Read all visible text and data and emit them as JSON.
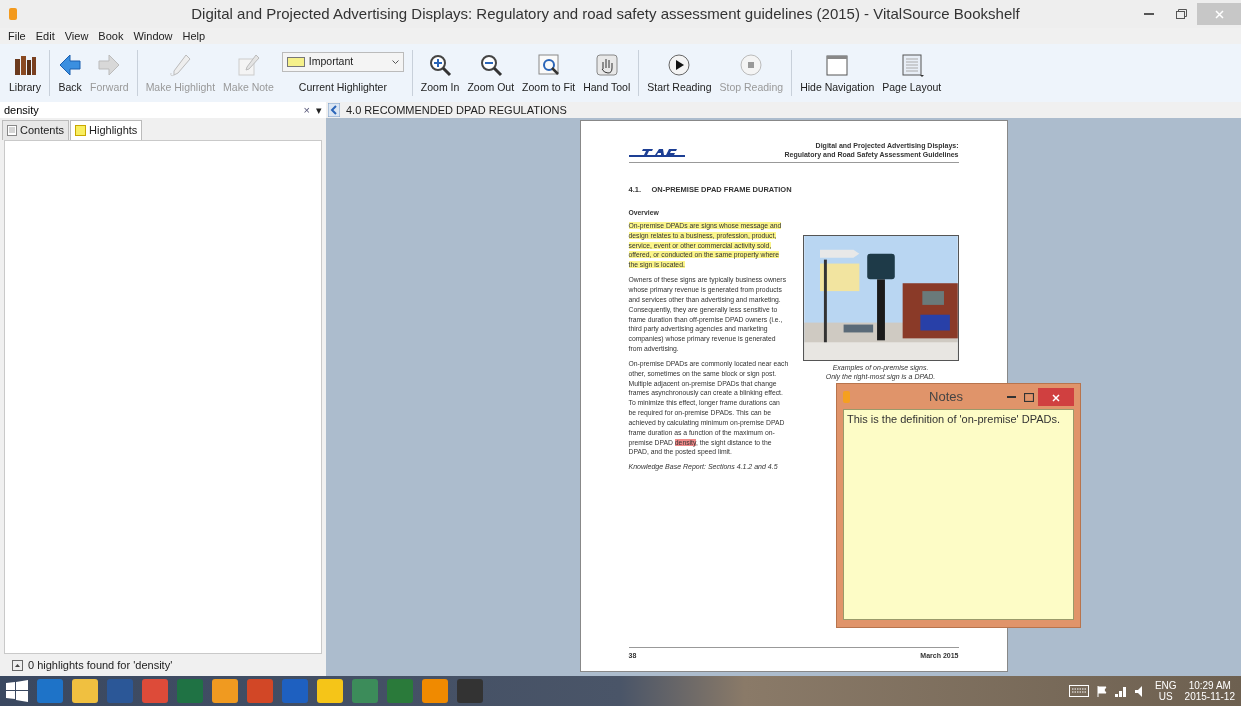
{
  "window": {
    "title": "Digital and Projected Advertising Displays: Regulatory and road safety assessment guidelines (2015) - VitalSource Bookshelf"
  },
  "menu": [
    "File",
    "Edit",
    "View",
    "Book",
    "Window",
    "Help"
  ],
  "toolbar": [
    {
      "kind": "button",
      "label": "Library",
      "disabled": false
    },
    {
      "kind": "separator"
    },
    {
      "kind": "button",
      "label": "Back",
      "disabled": false
    },
    {
      "kind": "button",
      "label": "Forward",
      "disabled": true
    },
    {
      "kind": "separator"
    },
    {
      "kind": "button",
      "label": "Make Highlight",
      "disabled": true
    },
    {
      "kind": "button",
      "label": "Make Note",
      "disabled": true
    },
    {
      "kind": "dropdown",
      "value": "Important",
      "color": "#f5f08a",
      "label": "Current Highlighter",
      "disabled": false
    },
    {
      "kind": "separator"
    },
    {
      "kind": "button",
      "label": "Zoom In",
      "disabled": false
    },
    {
      "kind": "button",
      "label": "Zoom Out",
      "disabled": false
    },
    {
      "kind": "button",
      "label": "Zoom to Fit",
      "disabled": false
    },
    {
      "kind": "button",
      "label": "Hand Tool",
      "disabled": false
    },
    {
      "kind": "separator"
    },
    {
      "kind": "button",
      "label": "Start Reading",
      "disabled": false
    },
    {
      "kind": "button",
      "label": "Stop Reading",
      "disabled": true
    },
    {
      "kind": "separator"
    },
    {
      "kind": "button",
      "label": "Hide Navigation",
      "disabled": false
    },
    {
      "kind": "button",
      "label": "Page Layout",
      "disabled": false
    }
  ],
  "search": {
    "value": "density",
    "clear": "×",
    "menu": "▾"
  },
  "nav_tabs": [
    {
      "label": "Contents",
      "selected": false
    },
    {
      "label": "Highlights",
      "selected": true
    }
  ],
  "status": "0 highlights found for 'density'",
  "breadcrumb": "4.0 RECOMMENDED DPAD REGULATIONS",
  "page": {
    "header": [
      "Digital and Projected Advertising Displays:",
      "Regulatory and Road Safety Assessment Guidelines"
    ],
    "section": "4.1.     ON-PREMISE DPAD FRAME DURATION",
    "subhead": "Overview",
    "paragraphs": [
      {
        "kind": "body",
        "segments": [
          {
            "text": "On-premise DPADs are signs whose message and design relates to a business, profession, product, service, event or other commercial activity sold, offered, or conducted on the same property where the sign is located.",
            "highlighted": true,
            "color": "#fbf58a"
          }
        ]
      },
      {
        "kind": "body",
        "segments": [
          {
            "text": "Owners of these signs are typically business owners whose primary revenue is generated from products and services other than advertising and marketing. Consequently, they are generally less sensitive to frame duration than off-premise DPAD owners (i.e., third party advertising agencies and marketing companies) whose primary revenue is generated from advertising.",
            "highlighted": false
          }
        ]
      },
      {
        "kind": "body",
        "segments": [
          {
            "text": "On-premise DPADs are commonly located near each other, sometimes on the same block or sign post. Multiple adjacent on-premise DPADs that change frames asynchronously can create a blinking effect. To minimize this effect, longer frame durations can be required for on-premise DPADs. This can be achieved by calculating minimum on-premise DPAD frame duration as a function of the maximum on-premise DPAD ",
            "highlighted": false
          },
          {
            "text": "density",
            "highlighted": true,
            "color": "#f08a8a"
          },
          {
            "text": ", the sight distance to the DPAD, and the posted speed limit.",
            "highlighted": false
          }
        ]
      },
      {
        "kind": "reference",
        "segments": [
          {
            "text": "Knowledge Base Report: Sections 4.1.2 and 4.5",
            "highlighted": false
          }
        ]
      }
    ],
    "caption": [
      "Examples of on-premise signs.",
      "Only the right-most sign is a DPAD."
    ],
    "footer": {
      "number": "38",
      "date": "March 2015"
    }
  },
  "note": {
    "title": "Notes",
    "text": "This is the definition of 'on-premise' DPADs."
  },
  "taskbar": {
    "apps": [
      {
        "color": "#1e73c8"
      },
      {
        "color": "#f0c040"
      },
      {
        "color": "#2b5797"
      },
      {
        "color": "#dd4b39"
      },
      {
        "color": "#1f7244"
      },
      {
        "color": "#f09a20"
      },
      {
        "color": "#d24726"
      },
      {
        "color": "#1e60c0"
      },
      {
        "color": "#f5c518"
      },
      {
        "color": "#3c8c5a"
      },
      {
        "color": "#2a7a3a"
      },
      {
        "color": "#f08a00"
      },
      {
        "color": "#333333"
      }
    ],
    "language": "ENG",
    "region": "US",
    "time": "10:29 AM",
    "date": "2015-11-12"
  }
}
